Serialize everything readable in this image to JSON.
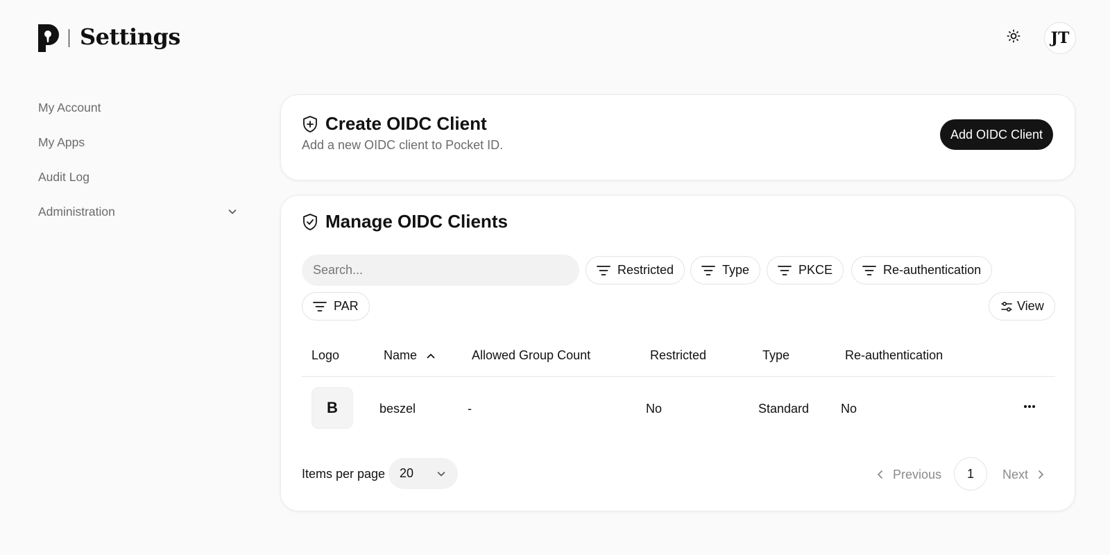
{
  "header": {
    "app_title": "Settings",
    "avatar_initials": "JT"
  },
  "sidebar": {
    "items": [
      {
        "label": "My Account"
      },
      {
        "label": "My Apps"
      },
      {
        "label": "Audit Log"
      },
      {
        "label": "Administration"
      }
    ]
  },
  "create_card": {
    "title": "Create OIDC Client",
    "description": "Add a new OIDC client to Pocket ID.",
    "button_label": "Add OIDC Client"
  },
  "manage_card": {
    "title": "Manage OIDC Clients",
    "search_placeholder": "Search...",
    "filters": [
      "Restricted",
      "Type",
      "PKCE",
      "Re-authentication",
      "PAR"
    ],
    "view_label": "View",
    "columns": [
      "Logo",
      "Name",
      "Allowed Group Count",
      "Restricted",
      "Type",
      "Re-authentication"
    ],
    "rows": [
      {
        "logo_letter": "B",
        "name": "beszel",
        "allowed_group_count": "-",
        "restricted": "No",
        "type": "Standard",
        "reauthentication": "No"
      }
    ],
    "items_per_page_label": "Items per page",
    "items_per_page": "20",
    "pagination": {
      "previous": "Previous",
      "current_page": "1",
      "next": "Next"
    }
  }
}
